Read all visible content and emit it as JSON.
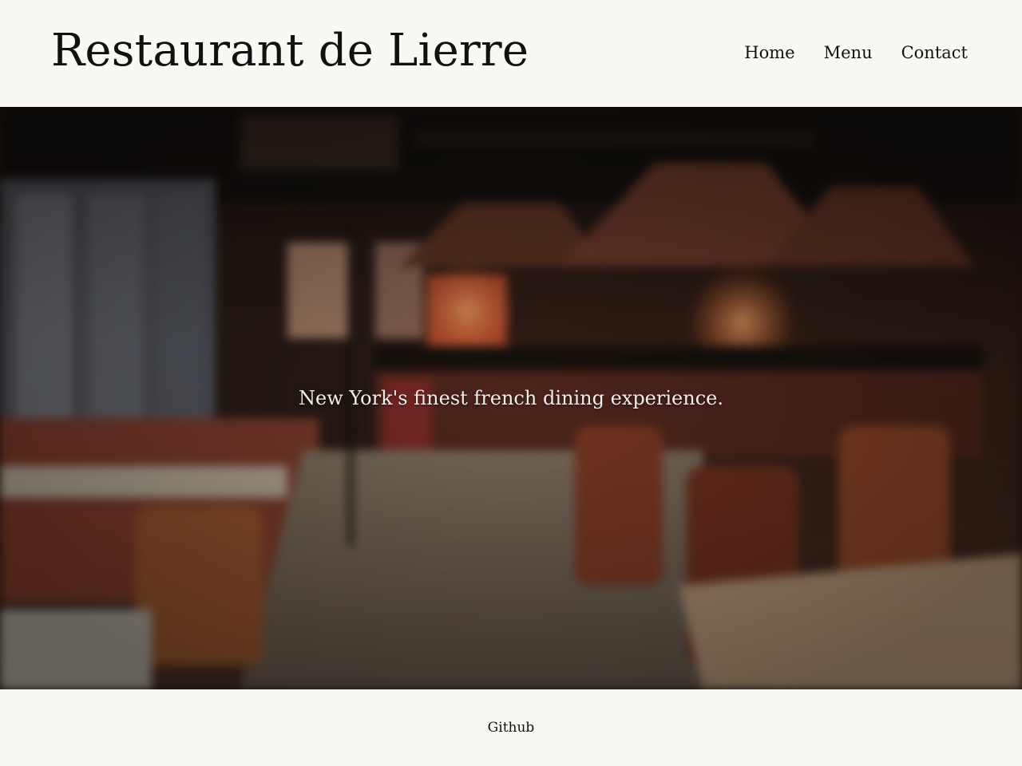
{
  "header": {
    "site_title": "Restaurant de Lierre",
    "nav": [
      {
        "label": "Home"
      },
      {
        "label": "Menu"
      },
      {
        "label": "Contact"
      }
    ]
  },
  "hero": {
    "tagline": "New York's finest french dining experience.",
    "image": "restaurant-interior-photo"
  },
  "footer": {
    "link_label": "Github"
  },
  "colors": {
    "page_background": "#f9f8f4",
    "text": "#111111",
    "tagline_text": "#f2eee8"
  }
}
